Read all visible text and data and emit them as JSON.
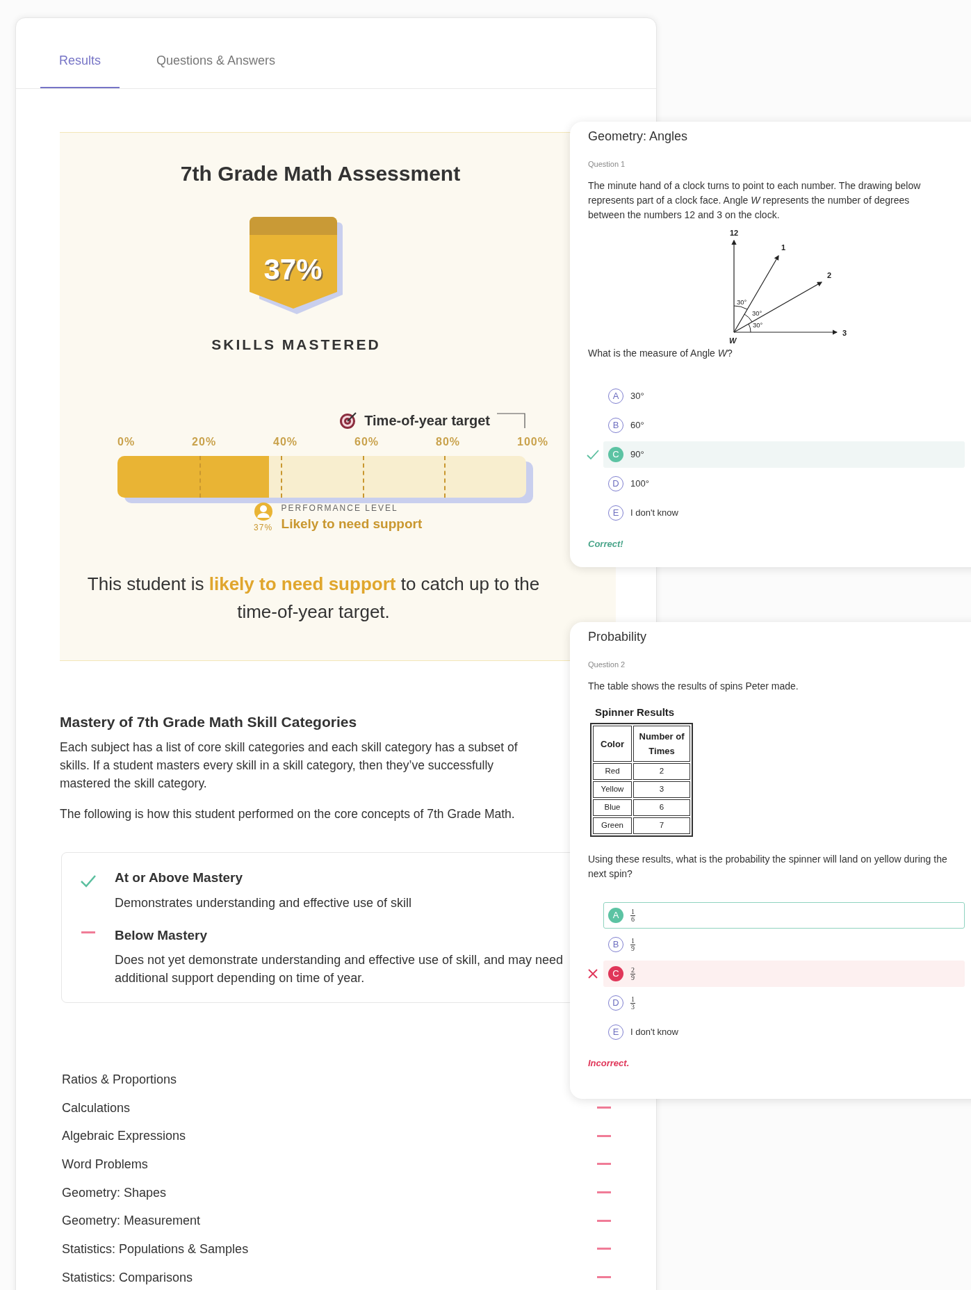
{
  "tabs": [
    {
      "label": "Results",
      "selected": true
    },
    {
      "label": "Questions & Answers",
      "selected": false
    }
  ],
  "report": {
    "title": "7th Grade Math Assessment",
    "badge": "37%",
    "badge_caption": "SKILLS MASTERED",
    "target_label": "Time-of-year target",
    "ticks": [
      "0%",
      "20%",
      "40%",
      "60%",
      "80%",
      "100%"
    ],
    "level": 0.37,
    "marker_value": "37%",
    "performance_caption": "PERFORMANCE LEVEL",
    "performance": "Likely to need support",
    "summary": {
      "before": "This student is ",
      "highlight": "likely to need support",
      "after": " to catch up to the time-of-year target."
    }
  },
  "mastery": {
    "heading": "Mastery of 7th Grade Math Skill Categories",
    "paragraphs": [
      "Each subject has a list of core skill categories and each skill category has a subset of skills. If a student masters every skill in a skill category, then they’ve successfully mastered the skill category.",
      "The following is how this student performed on the core concepts of 7th Grade Math."
    ],
    "legend": [
      {
        "mastered": true,
        "title": "At or Above Mastery",
        "text": "Demonstrates understanding and effective use of skill"
      },
      {
        "mastered": false,
        "title": "Below Mastery",
        "text": "Does not yet demonstrate understanding and effective use of skill, and may need additional support depending on time of year."
      }
    ],
    "skills": [
      {
        "name": "Ratios & Proportions"
      },
      {
        "name": "Calculations",
        "mastered": false
      },
      {
        "name": "Algebraic Expressions",
        "mastered": false
      },
      {
        "name": "Word Problems",
        "mastered": false
      },
      {
        "name": "Geometry: Shapes",
        "mastered": false
      },
      {
        "name": "Geometry: Measurement",
        "mastered": false
      },
      {
        "name": "Statistics: Populations & Samples",
        "mastered": false
      },
      {
        "name": "Statistics: Comparisons",
        "mastered": false
      }
    ]
  },
  "questions": [
    {
      "topic": "Geometry: Angles",
      "label": "Question 1",
      "text": "The minute hand of a clock turns to point to each number. The drawing below represents part of a clock face. Angle *W* represents the number of degrees between the numbers 12 and 3 on the clock.",
      "figure": {
        "kind": "clock_angles",
        "labels": [
          "12",
          "1",
          "2",
          "3"
        ],
        "vertex": "W",
        "angles": [
          "30°",
          "30°",
          "30°"
        ]
      },
      "prompt": "What is the measure of Angle *W*?",
      "choices": [
        {
          "letter": "A",
          "kind": "text",
          "text": "30°",
          "selected": false,
          "correct": false
        },
        {
          "letter": "B",
          "kind": "text",
          "text": "60°",
          "selected": false,
          "correct": false
        },
        {
          "letter": "C",
          "kind": "text",
          "text": "90°",
          "selected": true,
          "correct": true
        },
        {
          "letter": "D",
          "kind": "text",
          "text": "100°",
          "selected": false,
          "correct": false
        },
        {
          "letter": "E",
          "kind": "text",
          "text": "I don't know",
          "selected": false,
          "correct": false
        }
      ],
      "result": {
        "text": "Correct!",
        "correct": true
      }
    },
    {
      "topic": "Probability",
      "label": "Question 2",
      "text": "The table shows the results of spins Peter made.",
      "figure": {
        "kind": "table",
        "title": "Spinner Results",
        "columns": [
          "Color",
          "Number of Times"
        ],
        "rows": [
          [
            "Red",
            "2"
          ],
          [
            "Yellow",
            "3"
          ],
          [
            "Blue",
            "6"
          ],
          [
            "Green",
            "7"
          ]
        ]
      },
      "prompt": "Using these results, what is the probability the spinner will land on yellow during the next spin?",
      "choices": [
        {
          "letter": "A",
          "kind": "fraction",
          "numerator": "1",
          "denominator": "6",
          "selected": false,
          "correct": true
        },
        {
          "letter": "B",
          "kind": "fraction",
          "numerator": "1",
          "denominator": "9",
          "selected": false,
          "correct": false
        },
        {
          "letter": "C",
          "kind": "fraction",
          "numerator": "2",
          "denominator": "9",
          "selected": true,
          "correct": false
        },
        {
          "letter": "D",
          "kind": "fraction",
          "numerator": "1",
          "denominator": "3",
          "selected": false,
          "correct": false
        },
        {
          "letter": "E",
          "kind": "text",
          "text": "I don't know",
          "selected": false,
          "correct": false
        }
      ],
      "result": {
        "text": "Incorrect.",
        "correct": false
      }
    }
  ]
}
